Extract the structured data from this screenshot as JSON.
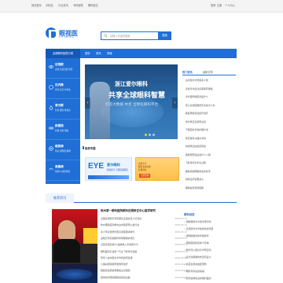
{
  "topbar": {
    "left_links": [
      "网站首页",
      "手机站",
      "行业资讯",
      "专科医院",
      "眼科医生"
    ],
    "right_links": [
      "登录",
      "注册",
      "个人中心"
    ]
  },
  "header": {
    "logo_text": "眼视医",
    "logo_sub": "EYE MEDICAL",
    "search_placeholder": "请输入关键词搜索",
    "search_button": "搜索"
  },
  "nav": {
    "category_label": "全部眼科医院分类",
    "items": [
      "首页",
      "资讯",
      "商城"
    ]
  },
  "sidebar": {
    "items": [
      {
        "title": "近视眼",
        "links": "近视 高度近视 假性"
      },
      {
        "title": "白内障",
        "links": "老年 先天 外伤性"
      },
      {
        "title": "青光眼",
        "links": "急性 慢性 继发性"
      },
      {
        "title": "斜弱视",
        "links": "斜视 弱视 眼震"
      },
      {
        "title": "眼底病",
        "links": "黄斑 视网膜 糖网"
      },
      {
        "title": "角膜病",
        "links": "角膜炎 圆锥角膜"
      }
    ]
  },
  "banner": {
    "line1": "浙江爱尔眼科",
    "line2": "共享全球眼科智慧",
    "line3": "打造大数据 共享 全球化眼科平台"
  },
  "recommend": {
    "title": "推荐专题",
    "ad1": {
      "logo": "EYE",
      "name": "爱尔眼科",
      "desc": "预约挂号 全国连锁医院"
    },
    "ad2": {
      "lines": [
        "近视手术",
        "眼科专家在线",
        "免费预约"
      ],
      "badge": "立即咨询"
    }
  },
  "right_news": {
    "tabs": [
      "热门资讯",
      "最新文章"
    ],
    "items": [
      "白内障手术费用多少钱",
      "近视手术后注意事项有哪些",
      "青光眼早期症状是什么",
      "孩子近视度数增长太快怎么办",
      "眼底黄斑病变如何治疗",
      "激光矫正近视安全吗",
      "干眼症的日常护理方法",
      "老花眼可以做手术吗",
      "斜视矫正的最佳年龄",
      "角膜塑形镜适合什么人群",
      "飞秒激光手术全过程",
      "糖尿病视网膜病变的危害",
      "弱视治疗需要多久",
      "眼睛疲劳如何缓解"
    ]
  },
  "section2": {
    "title": "推荐资讯",
    "headline": "杭州第一眼科医院眼科近视矫正中心医学研究",
    "rows": [
      {
        "text": "全国近视防控专家团队走进社区义诊活动",
        "date": "2019-05-13"
      },
      {
        "text": "杭州眼科医院举办白内障复明公益行动",
        "date": "2019-05-13"
      },
      {
        "text": "青少年近视防控知识讲座圆满举行",
        "date": "2019-05-12"
      },
      {
        "text": "爱眼日专家提醒科学用眼保护视力",
        "date": "2019-05-12"
      },
      {
        "text": "高度近视患者ICL晶体植入术案例分享",
        "date": "2019-05-11"
      },
      {
        "text": "眼科医院引进新一代全飞秒激光设备",
        "date": "2019-05-11"
      },
      {
        "text": "老年人白内障手术时机如何选择",
        "date": "2019-05-10"
      },
      {
        "text": "儿童斜视弱视早发现早治疗",
        "date": "2019-05-10"
      },
      {
        "text": "眼底检查能发现哪些全身疾病",
        "date": "2019-05-09"
      },
      {
        "text": "夏季如何预防眼部感染和过敏",
        "date": "2019-05-09"
      }
    ],
    "right_title": "眼科动态",
    "right_items": [
      "角膜移植手术成功率高吗",
      "近视激光手术前的检查项目",
      "视网膜脱离的早期信号",
      "眼科医院排名前十名单",
      "散光可以通过手术矫正吗",
      "蓝光对眼睛的伤害有多大",
      "高度近视并发症预防",
      "眼科专家在线答疑",
      "如何选择合适的眼科医院"
    ]
  }
}
